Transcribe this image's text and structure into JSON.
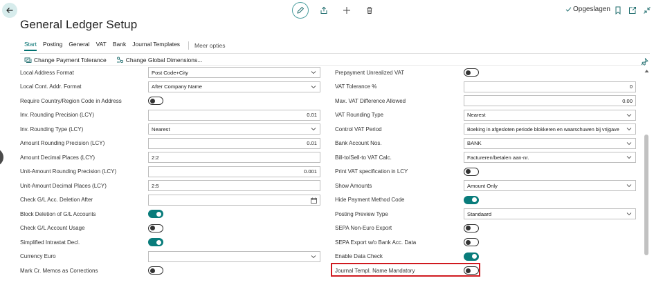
{
  "header": {
    "title": "General Ledger Setup",
    "saved_label": "Opgeslagen"
  },
  "tabs": [
    {
      "label": "Start",
      "active": true
    },
    {
      "label": "Posting",
      "active": false
    },
    {
      "label": "General",
      "active": false
    },
    {
      "label": "VAT",
      "active": false
    },
    {
      "label": "Bank",
      "active": false
    },
    {
      "label": "Journal Templates",
      "active": false
    }
  ],
  "more_options": "Meer opties",
  "actions": [
    {
      "label": "Change Payment Tolerance",
      "icon": "payment-tolerance-icon"
    },
    {
      "label": "Change Global Dimensions...",
      "icon": "dimensions-icon"
    }
  ],
  "left_fields": [
    {
      "label": "Local Address Format",
      "type": "select",
      "value": "Post Code+City"
    },
    {
      "label": "Local Cont. Addr. Format",
      "type": "select",
      "value": "After Company Name"
    },
    {
      "label": "Require Country/Region Code in Address",
      "type": "toggle",
      "on": false
    },
    {
      "label": "Inv. Rounding Precision (LCY)",
      "type": "number",
      "value": "0.01"
    },
    {
      "label": "Inv. Rounding Type (LCY)",
      "type": "select",
      "value": "Nearest"
    },
    {
      "label": "Amount Rounding Precision (LCY)",
      "type": "number",
      "value": "0.01"
    },
    {
      "label": "Amount Decimal Places (LCY)",
      "type": "text",
      "value": "2:2"
    },
    {
      "label": "Unit-Amount Rounding Precision (LCY)",
      "type": "number",
      "value": "0.001"
    },
    {
      "label": "Unit-Amount Decimal Places (LCY)",
      "type": "text",
      "value": "2:5"
    },
    {
      "label": "Check G/L Acc. Deletion After",
      "type": "date",
      "value": ""
    },
    {
      "label": "Block Deletion of G/L Accounts",
      "type": "toggle",
      "on": true
    },
    {
      "label": "Check G/L Account Usage",
      "type": "toggle",
      "on": false
    },
    {
      "label": "Simplified Intrastat Decl.",
      "type": "toggle",
      "on": true
    },
    {
      "label": "Currency Euro",
      "type": "select",
      "value": ""
    },
    {
      "label": "Mark Cr. Memos as Corrections",
      "type": "toggle",
      "on": false
    }
  ],
  "right_fields": [
    {
      "label": "Prepayment Unrealized VAT",
      "type": "toggle",
      "on": false
    },
    {
      "label": "VAT Tolerance %",
      "type": "number",
      "value": "0"
    },
    {
      "label": "Max. VAT Difference Allowed",
      "type": "number",
      "value": "0.00"
    },
    {
      "label": "VAT Rounding Type",
      "type": "select",
      "value": "Nearest"
    },
    {
      "label": "Control VAT Period",
      "type": "select",
      "value": "Boeking in afgesloten periode blokkeren en waarschuwen bij vrijgave"
    },
    {
      "label": "Bank Account Nos.",
      "type": "select",
      "value": "BANK"
    },
    {
      "label": "Bill-to/Sell-to VAT Calc.",
      "type": "select",
      "value": "Factureren/betalen aan-nr."
    },
    {
      "label": "Print VAT specification in LCY",
      "type": "toggle",
      "on": false
    },
    {
      "label": "Show Amounts",
      "type": "select",
      "value": "Amount Only"
    },
    {
      "label": "Hide Payment Method Code",
      "type": "toggle",
      "on": true
    },
    {
      "label": "Posting Preview Type",
      "type": "select",
      "value": "Standaard"
    },
    {
      "label": "SEPA Non-Euro Export",
      "type": "toggle",
      "on": false
    },
    {
      "label": "SEPA Export w/o Bank Acc. Data",
      "type": "toggle",
      "on": false
    },
    {
      "label": "Enable Data Check",
      "type": "toggle",
      "on": true
    },
    {
      "label": "Journal Templ. Name Mandatory",
      "type": "toggle",
      "on": false,
      "highlighted": true
    }
  ],
  "colors": {
    "accent": "#00706f",
    "toggle_on": "#097c7b",
    "highlight": "#d0191f"
  }
}
